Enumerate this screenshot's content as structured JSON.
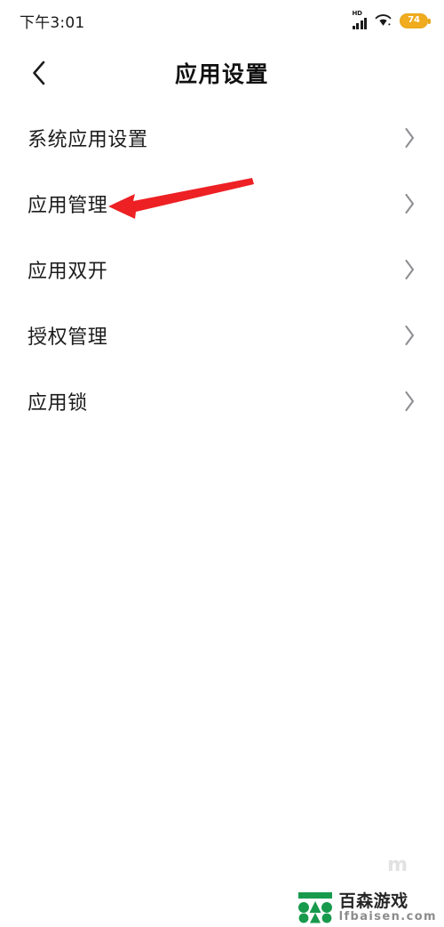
{
  "status_bar": {
    "time": "下午3:01",
    "network_label": "HD",
    "signal_icon": "signal-bars-icon",
    "wifi_icon": "wifi-icon",
    "battery_level": "74",
    "battery_color": "#f0ab1e"
  },
  "header": {
    "back_icon": "chevron-left-icon",
    "title": "应用设置"
  },
  "list": {
    "chevron_icon": "chevron-right-icon",
    "items": [
      {
        "label": "系统应用设置"
      },
      {
        "label": "应用管理"
      },
      {
        "label": "应用双开"
      },
      {
        "label": "授权管理"
      },
      {
        "label": "应用锁"
      }
    ]
  },
  "annotation": {
    "type": "arrow",
    "color": "#ed1c24",
    "points_to": "应用管理",
    "direction": "left"
  },
  "watermark": {
    "faint_mark": "m",
    "logo_icon": "baisen-logo-icon",
    "logo_color": "#179a4c",
    "brand_cn": "百森游戏",
    "brand_url": "lfbaisen.com"
  }
}
